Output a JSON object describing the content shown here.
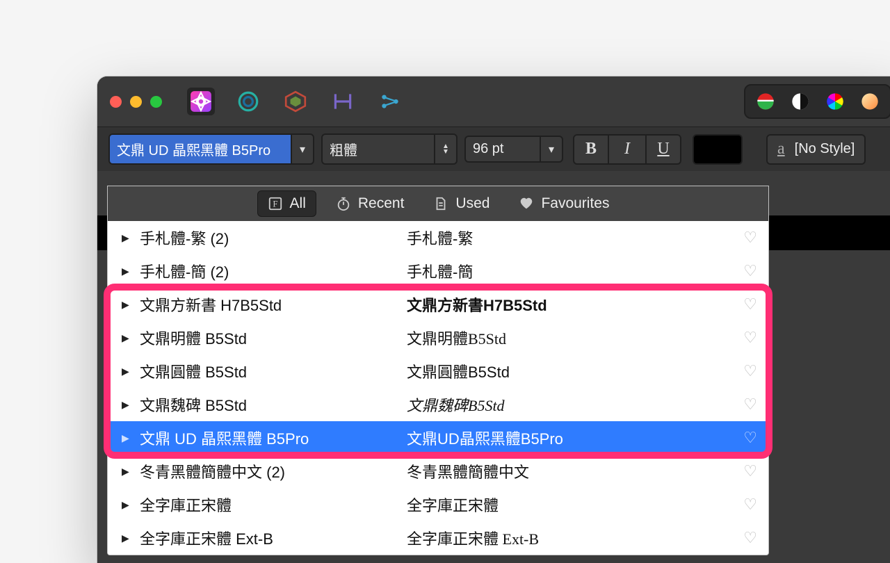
{
  "toolbar": {
    "font_name": "文鼎 UD 晶熙黑體 B5Pro",
    "font_style": "粗體",
    "font_size": "96 pt",
    "bold": "B",
    "italic": "I",
    "underline": "U",
    "charstyle_label": "[No Style]"
  },
  "dropdown": {
    "tabs": {
      "all": "All",
      "recent": "Recent",
      "used": "Used",
      "favourites": "Favourites"
    },
    "fonts": [
      {
        "name": "手札體-繁 (2)",
        "preview": "手札體-繁",
        "pv_class": "",
        "selected": false
      },
      {
        "name": "手札體-簡 (2)",
        "preview": "手札體-簡",
        "pv_class": "",
        "selected": false
      },
      {
        "name": "文鼎方新書 H7B5Std",
        "preview": "文鼎方新書H7B5Std",
        "pv_class": "pv-bold",
        "selected": false
      },
      {
        "name": "文鼎明體 B5Std",
        "preview": "文鼎明體B5Std",
        "pv_class": "pv-serif",
        "selected": false
      },
      {
        "name": "文鼎圓體 B5Std",
        "preview": "文鼎圓體B5Std",
        "pv_class": "",
        "selected": false
      },
      {
        "name": "文鼎魏碑 B5Std",
        "preview": "文鼎魏碑B5Std",
        "pv_class": "pv-script",
        "selected": false
      },
      {
        "name": "文鼎 UD 晶熙黑體 B5Pro",
        "preview": "文鼎UD晶熙黑體B5Pro",
        "pv_class": "",
        "selected": true
      },
      {
        "name": "冬青黑體簡體中文 (2)",
        "preview": "冬青黑體簡體中文",
        "pv_class": "",
        "selected": false
      },
      {
        "name": "全字庫正宋體",
        "preview": "全字庫正宋體",
        "pv_class": "pv-serif",
        "selected": false
      },
      {
        "name": "全字庫正宋體 Ext-B",
        "preview": "全字庫正宋體 Ext-B",
        "pv_class": "pv-serif",
        "selected": false
      }
    ]
  },
  "highlight": {
    "first_index": 2,
    "last_index": 6
  }
}
